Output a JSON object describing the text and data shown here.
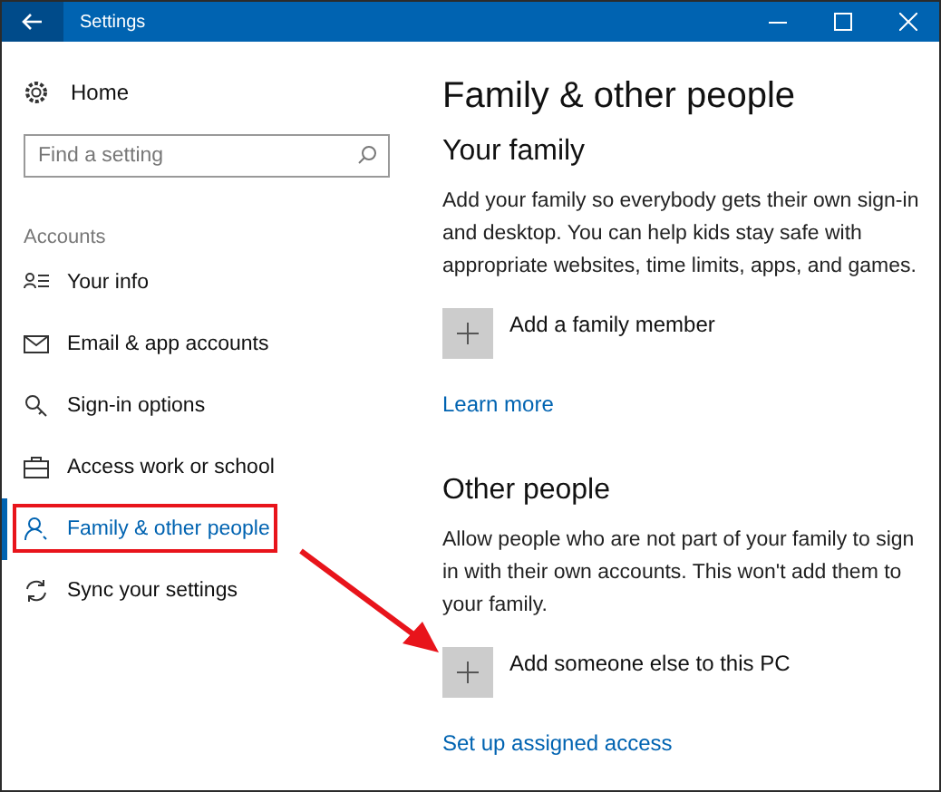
{
  "window": {
    "title": "Settings"
  },
  "sidebar": {
    "home": "Home",
    "search": {
      "placeholder": "Find a setting"
    },
    "section": "Accounts",
    "items": [
      {
        "label": "Your info",
        "selected": false,
        "highlighted": false
      },
      {
        "label": "Email & app accounts",
        "selected": false,
        "highlighted": false
      },
      {
        "label": "Sign-in options",
        "selected": false,
        "highlighted": false
      },
      {
        "label": "Access work or school",
        "selected": false,
        "highlighted": false
      },
      {
        "label": "Family & other people",
        "selected": true,
        "highlighted": true
      },
      {
        "label": "Sync your settings",
        "selected": false,
        "highlighted": false
      }
    ]
  },
  "page": {
    "title": "Family & other people",
    "sections": [
      {
        "heading": "Your family",
        "text": "Add your family so everybody gets their own sign-in and desktop. You can help kids stay safe with appropriate websites, time limits, apps, and games.",
        "action": {
          "label": "Add a family member",
          "arrow": false
        },
        "link": "Learn more"
      },
      {
        "heading": "Other people",
        "text": "Allow people who are not part of your family to sign in with their own accounts. This won't add them to your family.",
        "action": {
          "label": "Add someone else to this PC",
          "arrow": true
        },
        "link": "Set up assigned access"
      }
    ]
  }
}
